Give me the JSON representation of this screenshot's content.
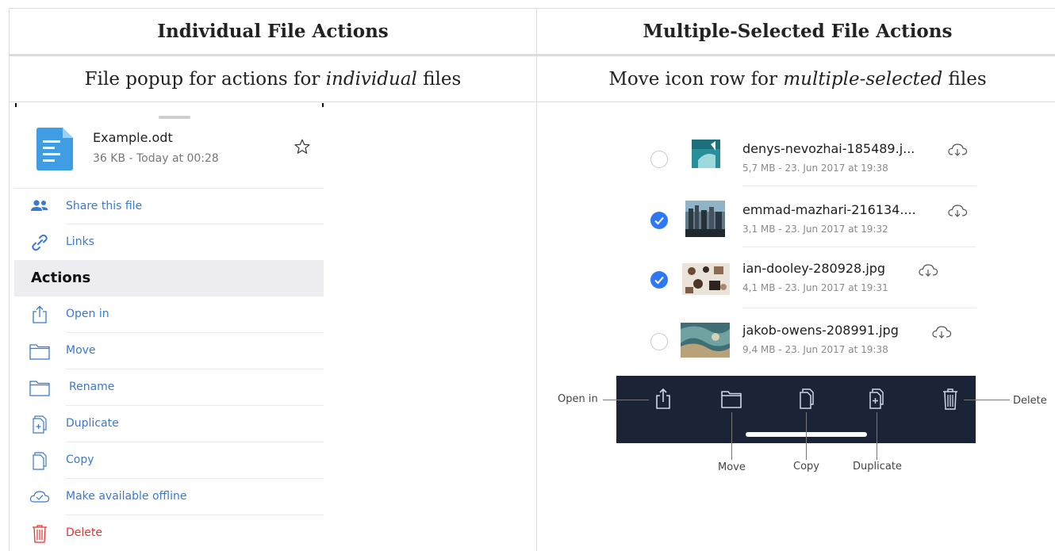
{
  "table": {
    "headers": [
      "Individual File Actions",
      "Multiple-Selected File Actions"
    ],
    "captions": [
      {
        "before": "File popup for actions for ",
        "emphasis": "individual",
        "after": " files"
      },
      {
        "before": "Move icon row for ",
        "emphasis": "multiple-selected",
        "after": " files"
      }
    ]
  },
  "popup": {
    "file_name": "Example.odt",
    "file_meta": "36 KB - Today at 00:28",
    "file_icon": "document-icon",
    "favorite_icon": "star-icon",
    "share_items": [
      {
        "label": "Share this file",
        "icon": "people-icon"
      },
      {
        "label": "Links",
        "icon": "link-icon"
      }
    ],
    "actions_header": "Actions",
    "actions": [
      {
        "label": "Open in",
        "icon": "share-icon"
      },
      {
        "label": "Move",
        "icon": "folder-icon"
      },
      {
        "label": "Rename",
        "icon": "folder-icon"
      },
      {
        "label": "Duplicate",
        "icon": "duplicate-icon"
      },
      {
        "label": "Copy",
        "icon": "copy-icon"
      },
      {
        "label": "Make available offline",
        "icon": "cloud-check-icon"
      },
      {
        "label": "Delete",
        "icon": "trash-icon"
      }
    ],
    "colors": {
      "link_blue": "#3979d0",
      "delete_red": "#e8322f",
      "file_blue": "#3f9de3",
      "section_bg": "#ececf1"
    }
  },
  "file_list": {
    "rows": [
      {
        "name": "denys-nevozhai-185489.j...",
        "meta": "5,7 MB - 23. Jun 2017 at 19:38",
        "selected": false
      },
      {
        "name": "emmad-mazhari-216134....",
        "meta": "3,1 MB - 23. Jun 2017 at 19:32",
        "selected": true
      },
      {
        "name": "ian-dooley-280928.jpg",
        "meta": "4,1 MB - 23. Jun 2017 at 19:31",
        "selected": true
      },
      {
        "name": "jakob-owens-208991.jpg",
        "meta": "9,4 MB - 23. Jun 2017 at 19:38",
        "selected": false
      }
    ],
    "colors": {
      "toolbar_bg": "#1b2337",
      "checkbox_selected": "#2f78f5"
    }
  },
  "toolbar": {
    "callouts": {
      "open_in": "Open in",
      "move": "Move",
      "copy": "Copy",
      "duplicate": "Duplicate",
      "delete": "Delete"
    },
    "icons": [
      "share-icon",
      "folder-icon",
      "copy-icon",
      "duplicate-icon",
      "trash-icon"
    ]
  }
}
